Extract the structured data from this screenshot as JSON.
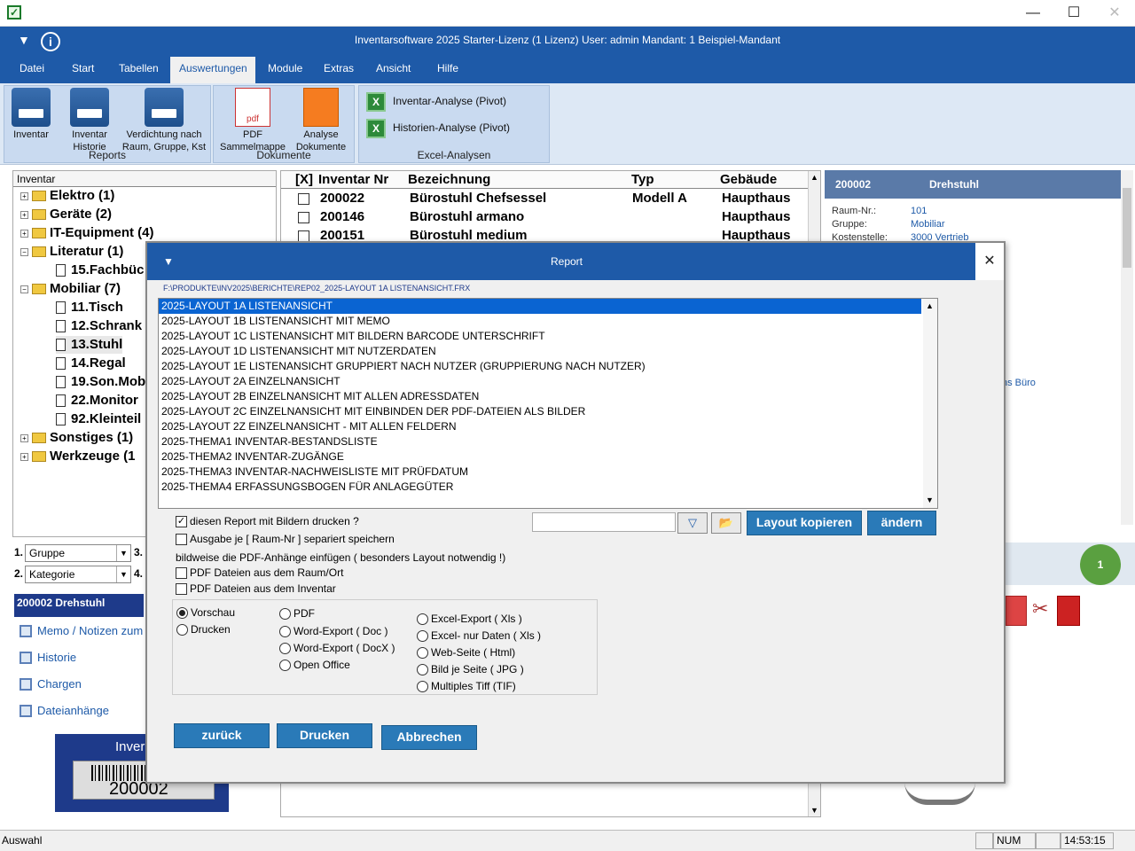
{
  "window": {
    "min": "—",
    "max": "☐",
    "close": "✕"
  },
  "app": {
    "title": "Inventarsoftware 2025 Starter-Lizenz (1 Lizenz)   User: admin    Mandant: 1 Beispiel-Mandant",
    "accent": "#1e5aa8"
  },
  "menu": [
    "Datei",
    "Start",
    "Tabellen",
    "Auswertungen",
    "Module",
    "Extras",
    "Ansicht",
    "Hilfe"
  ],
  "ribbon": {
    "reports": {
      "label": "Reports",
      "b1": "Inventar",
      "b2a": "Inventar",
      "b2b": "Historie",
      "b3a": "Verdichtung nach",
      "b3b": "Raum, Gruppe, Kst"
    },
    "dokumente": {
      "label": "Dokumente",
      "b1a": "PDF",
      "b1b": "Sammelmappe",
      "b2a": "Analyse",
      "b2b": "Dokumente",
      "pdf": "pdf"
    },
    "excel": {
      "label": "Excel-Analysen",
      "i1": "Inventar-Analyse (Pivot)",
      "i2": "Historien-Analyse (Pivot)"
    }
  },
  "tree": {
    "header": "Inventar",
    "items": [
      "Elektro  (1)",
      "Geräte  (2)",
      "IT-Equipment  (4)",
      "Literatur  (1)",
      "15.Fachbüc",
      "Mobiliar  (7)",
      "11.Tisch",
      "12.Schrank",
      "13.Stuhl",
      "14.Regal",
      "19.Son.Mob",
      "22.Monitor",
      "92.Kleinteil",
      "Sonstiges  (1)",
      "Werkzeuge  (1"
    ]
  },
  "grid": {
    "headers": [
      "[X]",
      "Inventar Nr",
      "Bezeichnung",
      "Typ",
      "Gebäude"
    ],
    "rows": [
      [
        "200022",
        "Bürostuhl Chefsessel",
        "Modell A",
        "Haupthaus"
      ],
      [
        "200146",
        "Bürostuhl armano",
        "",
        "Haupthaus"
      ],
      [
        "200151",
        "Bürostuhl medium",
        "",
        "Haupthaus"
      ]
    ]
  },
  "detail": {
    "id": "200002",
    "name": "Drehstuhl",
    "raum_label": "Raum-Nr.:",
    "raum": "101",
    "gruppe_label": "Gruppe:",
    "gruppe": "Mobiliar",
    "kst_label": "Kostenstelle:",
    "kst": "3000 Vertrieb",
    "buero": "ns Büro",
    "badge": "1"
  },
  "filters": {
    "n1": "1.",
    "f1": "Gruppe",
    "n3": "3.",
    "n2": "2.",
    "f2": "Kategorie",
    "n4": "4."
  },
  "leftnav": {
    "title": "200002 Drehstuhl",
    "links": [
      "Memo / Notizen zum",
      "Historie",
      "Chargen",
      "Dateianhänge"
    ],
    "label": "Inver",
    "barcode": "200002"
  },
  "status": {
    "left": "Auswahl",
    "num": "NUM",
    "time": "14:53:15"
  },
  "dialog": {
    "title": "Report",
    "close": "✕",
    "path": "F:\\PRODUKTE\\INV2025\\BERICHTE\\REP02_2025-LAYOUT 1A LISTENANSICHT.FRX",
    "reports": [
      "2025-LAYOUT 1A LISTENANSICHT",
      "2025-LAYOUT 1B LISTENANSICHT MIT MEMO",
      "2025-LAYOUT 1C LISTENANSICHT MIT BILDERN  BARCODE UNTERSCHRIFT",
      "2025-LAYOUT 1D LISTENANSICHT MIT NUTZERDATEN",
      "2025-LAYOUT 1E LISTENANSICHT GRUPPIERT NACH NUTZER (GRUPPIERUNG NACH NUTZER)",
      "2025-LAYOUT 2A EINZELNANSICHT",
      "2025-LAYOUT 2B EINZELNANSICHT MIT ALLEN ADRESSDATEN",
      "2025-LAYOUT 2C EINZELNANSICHT MIT EINBINDEN DER PDF-DATEIEN ALS BILDER",
      "2025-LAYOUT 2Z EINZELNANSICHT - MIT ALLEN FELDERN",
      "2025-THEMA1 INVENTAR-BESTANDSLISTE",
      "2025-THEMA2 INVENTAR-ZUGÄNGE",
      "2025-THEMA3 INVENTAR-NACHWEISLISTE MIT PRÜFDATUM",
      "2025-THEMA4 ERFASSUNGSBOGEN FÜR ANLAGEGÜTER"
    ],
    "opt_bilder": "diesen Report mit Bildern drucken ?",
    "opt_raum": "Ausgabe je [ Raum-Nr ] separiert speichern",
    "pdf_hint": "bildweise die PDF-Anhänge einfügen ( besonders Layout notwendig !)",
    "opt_pdf_raum": "PDF Dateien aus dem Raum/Ort",
    "opt_pdf_inv": "PDF Dateien aus dem Inventar",
    "btn_copy": "Layout kopieren",
    "btn_change": "ändern",
    "search_placeholder": "",
    "out1": [
      "Vorschau",
      "Drucken"
    ],
    "out2": [
      "PDF",
      "Word-Export ( Doc )",
      "Word-Export ( DocX )",
      "Open Office"
    ],
    "out3": [
      "Excel-Export ( Xls )",
      "Excel- nur Daten ( Xls )",
      "Web-Seite ( Html)",
      "Bild je Seite (  JPG )",
      "Multiples Tiff  (TIF)"
    ],
    "btn_back": "zurück",
    "btn_print": "Drucken",
    "btn_cancel": "Abbrechen"
  }
}
